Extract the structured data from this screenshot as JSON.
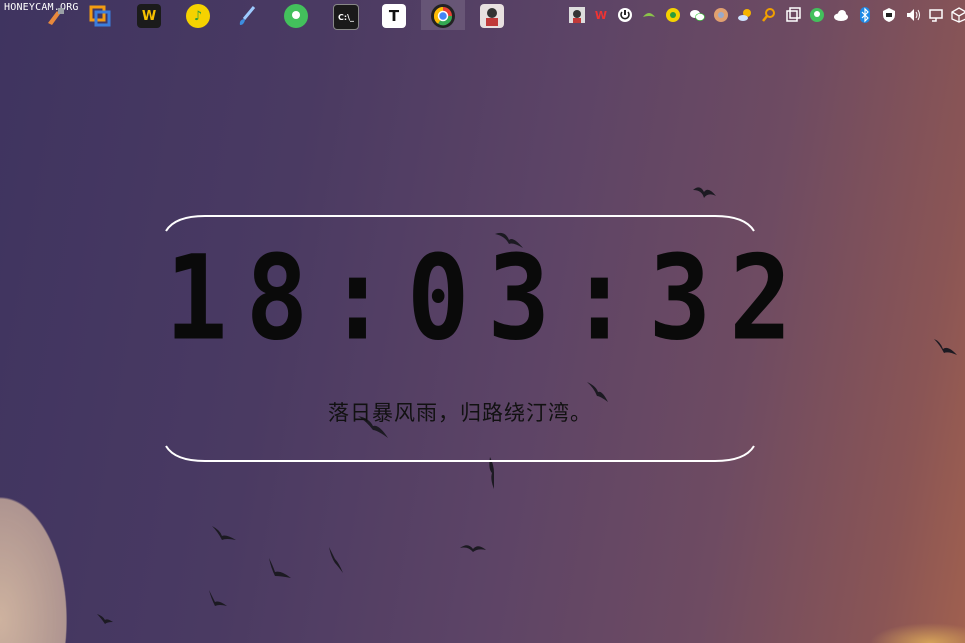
{
  "watermark": "HONEYCAM.ORG",
  "taskbar": {
    "apps": [
      {
        "name": "wps-icon",
        "glyph": "W",
        "color": "#f6c000"
      },
      {
        "name": "qq-music-icon",
        "glyph": "♪",
        "color": "#f5d200"
      },
      {
        "name": "paint-brush-icon",
        "glyph": "✎",
        "color": "#6fb7ff"
      },
      {
        "name": "green-app-icon",
        "glyph": "●",
        "color": "#43c05c"
      },
      {
        "name": "terminal-icon",
        "glyph": ">_",
        "color": "#222222"
      },
      {
        "name": "typora-icon",
        "glyph": "T",
        "color": "#ffffff"
      },
      {
        "name": "chrome-icon",
        "glyph": "◉",
        "color": "#e94235"
      },
      {
        "name": "avatar-app-icon",
        "glyph": "☺",
        "color": "#c03a3a"
      }
    ]
  },
  "clock": {
    "time": "18:03:32",
    "poem": "落日暴风雨，归路绕汀湾。"
  }
}
